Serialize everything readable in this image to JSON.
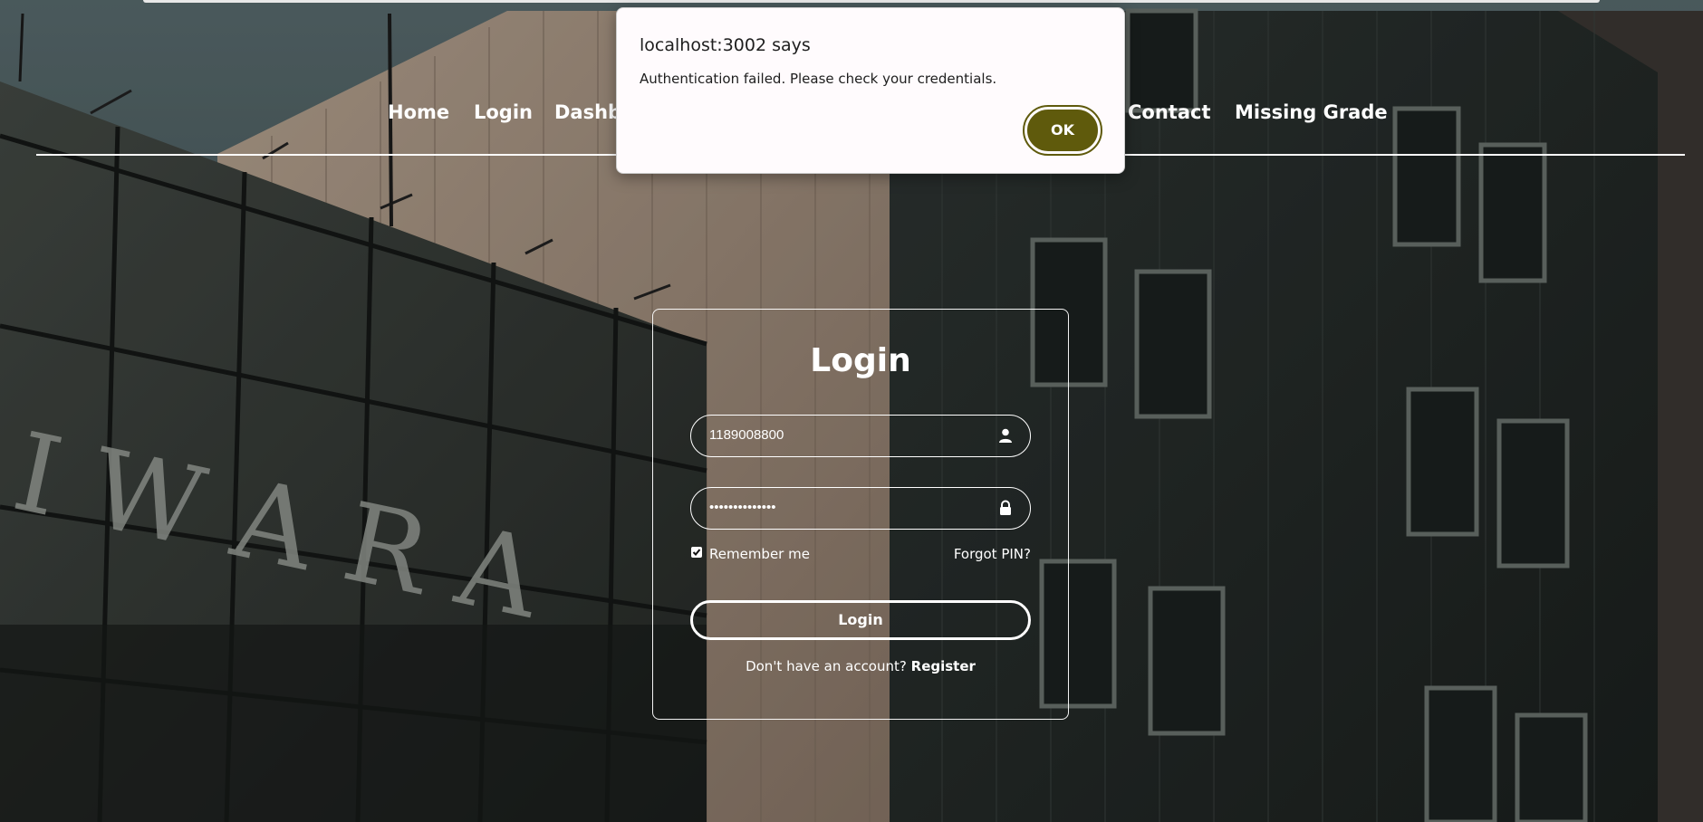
{
  "nav": {
    "items": [
      {
        "label": "Home"
      },
      {
        "label": "Login"
      },
      {
        "label": "Dashb"
      },
      {
        "label": "Contact"
      },
      {
        "label": "Missing Grade"
      }
    ]
  },
  "login": {
    "title": "Login",
    "username_value": "1189008800",
    "password_value": "••••••••••••••",
    "remember_label": "Remember me",
    "remember_checked": true,
    "forgot_label": "Forgot PIN?",
    "button_label": "Login",
    "register_prompt": "Don't have an account?",
    "register_link": "Register"
  },
  "dialog": {
    "title": "localhost:3002 says",
    "message": "Authentication failed. Please check your credentials.",
    "ok_label": "OK"
  },
  "colors": {
    "dialog_button": "#5f5a0c",
    "dialog_bg": "#fffbfd"
  },
  "icons": {
    "username": "user-icon",
    "password": "lock-icon",
    "checkbox": "checkmark-icon"
  }
}
